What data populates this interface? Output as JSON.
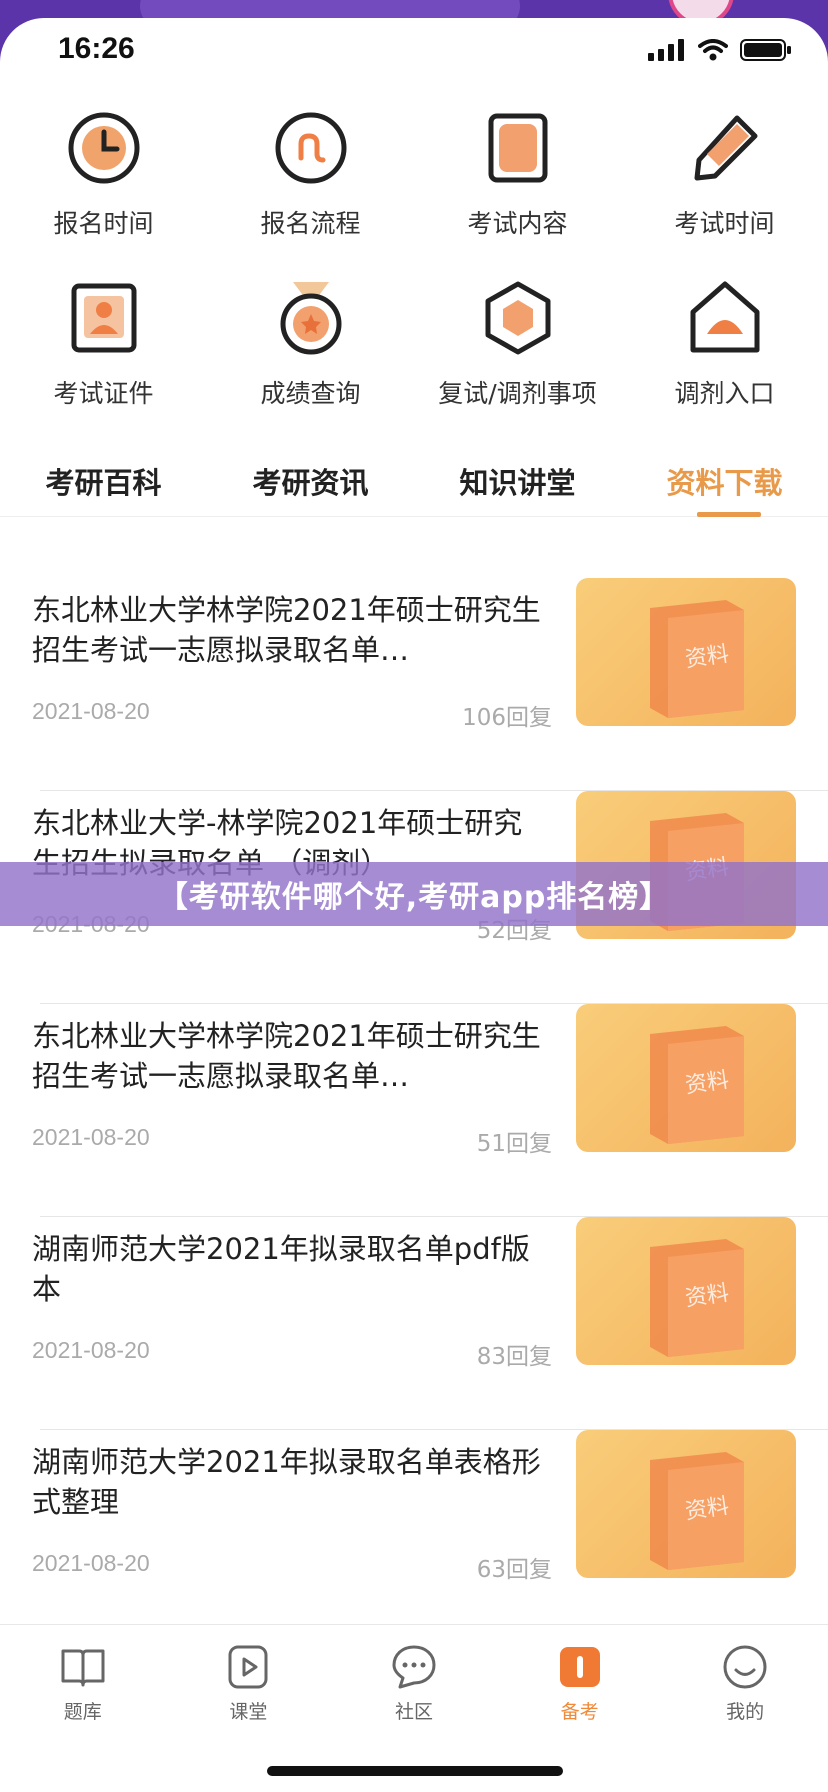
{
  "status_bar": {
    "time": "16:26"
  },
  "grid": [
    {
      "label": "报名时间",
      "icon": "clock-icon"
    },
    {
      "label": "报名流程",
      "icon": "flow-icon"
    },
    {
      "label": "考试内容",
      "icon": "document-icon"
    },
    {
      "label": "考试时间",
      "icon": "pencil-icon"
    },
    {
      "label": "考试证件",
      "icon": "id-card-icon"
    },
    {
      "label": "成绩查询",
      "icon": "medal-icon"
    },
    {
      "label": "复试/调剂事项",
      "icon": "hexagon-icon"
    },
    {
      "label": "调剂入口",
      "icon": "house-icon"
    }
  ],
  "tabs": [
    {
      "label": "考研百科"
    },
    {
      "label": "考研资讯"
    },
    {
      "label": "知识讲堂"
    },
    {
      "label": "资料下载",
      "active": true
    }
  ],
  "list": [
    {
      "title": "东北林业大学林学院2021年硕士研究生招生考试一志愿拟录取名单…",
      "date": "2021-08-20",
      "replies": "106回复",
      "thumb_text": "资料"
    },
    {
      "title": "东北林业大学-林学院2021年硕士研究生招生拟录取名单 （调剂）",
      "date": "2021-08-20",
      "replies": "52回复",
      "thumb_text": "资料"
    },
    {
      "title": "东北林业大学林学院2021年硕士研究生招生考试一志愿拟录取名单…",
      "date": "2021-08-20",
      "replies": "51回复",
      "thumb_text": "资料"
    },
    {
      "title": "湖南师范大学2021年拟录取名单pdf版本",
      "date": "2021-08-20",
      "replies": "83回复",
      "thumb_text": "资料"
    },
    {
      "title": "湖南师范大学2021年拟录取名单表格形式整理",
      "date": "2021-08-20",
      "replies": "63回复",
      "thumb_text": "资料"
    }
  ],
  "banner": {
    "text": "【考研软件哪个好,考研app排名榜】"
  },
  "bottom_nav": [
    {
      "label": "题库",
      "icon": "book-icon"
    },
    {
      "label": "课堂",
      "icon": "play-icon"
    },
    {
      "label": "社区",
      "icon": "chat-icon"
    },
    {
      "label": "备考",
      "icon": "prep-icon",
      "active": true
    },
    {
      "label": "我的",
      "icon": "smile-icon"
    }
  ],
  "colors": {
    "accent": "#e89a4a",
    "brand_purple": "#6b3fb8"
  }
}
